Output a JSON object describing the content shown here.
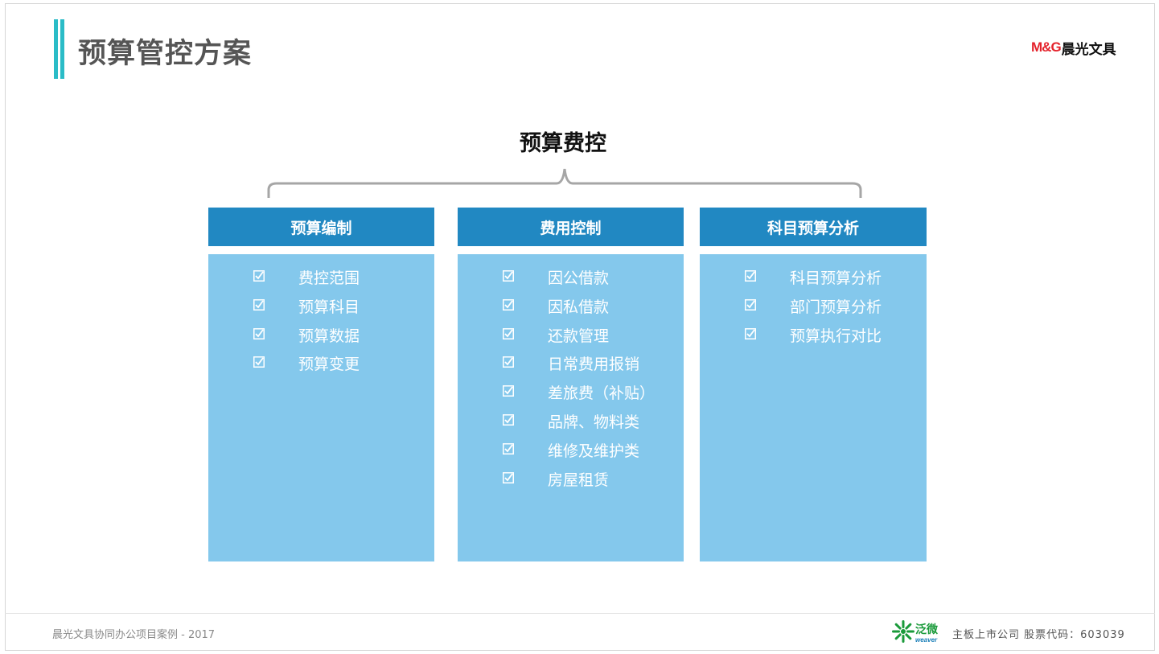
{
  "page": {
    "title": "预算管控方案",
    "logo_mg": "M&G",
    "logo_cn": "晨光文具"
  },
  "section": {
    "title": "预算费控"
  },
  "columns": [
    {
      "header": "预算编制",
      "items": [
        "费控范围",
        "预算科目",
        "预算数据",
        "预算变更"
      ]
    },
    {
      "header": "费用控制",
      "items": [
        "因公借款",
        "因私借款",
        "还款管理",
        "日常费用报销",
        "差旅费（补贴）",
        "品牌、物料类",
        "维修及维护类",
        "房屋租赁"
      ]
    },
    {
      "header": "科目预算分析",
      "items": [
        "科目预算分析",
        "部门预算分析",
        "预算执行对比"
      ]
    }
  ],
  "footer": {
    "left": "晨光文具协同办公项目案例 - 2017",
    "weaver_cn": "泛微",
    "weaver_en": "weaver",
    "right": "主板上市公司   股票代码：603039"
  },
  "colors": {
    "accent_bar": "#2bbcc7",
    "column_header": "#2188c2",
    "column_body": "#84c8ec",
    "logo_red": "#e4222b"
  },
  "icons": {
    "checkbox": "checkbox-checked-icon",
    "weaver_logo": "weaver-logo-icon"
  }
}
